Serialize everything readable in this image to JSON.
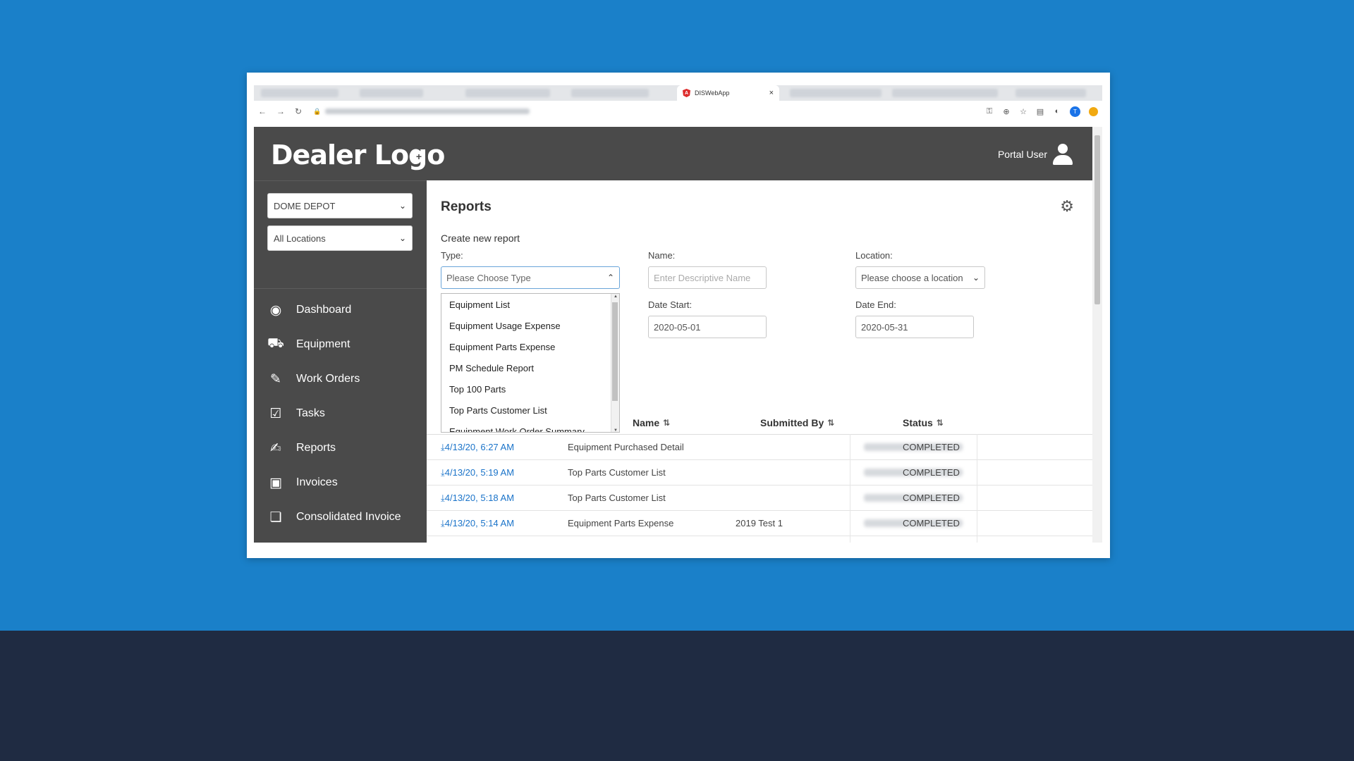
{
  "browser": {
    "active_tab_title": "DISWebApp",
    "tab_close": "×",
    "back": "←",
    "forward": "→",
    "reload": "↻",
    "lock": "🔒",
    "profile_initial": "T"
  },
  "header": {
    "logo": "Dealer Logo",
    "user_name": "Portal User"
  },
  "sidebar": {
    "customer_select": "DOME DEPOT",
    "location_select": "All Locations",
    "items": [
      {
        "label": "Dashboard",
        "icon": "eye-icon"
      },
      {
        "label": "Equipment",
        "icon": "forklift-icon"
      },
      {
        "label": "Work Orders",
        "icon": "clipboard-edit-icon"
      },
      {
        "label": "Tasks",
        "icon": "checkbox-icon"
      },
      {
        "label": "Reports",
        "icon": "report-icon"
      },
      {
        "label": "Invoices",
        "icon": "invoice-icon"
      },
      {
        "label": "Consolidated Invoice",
        "icon": "stacked-invoice-icon"
      }
    ]
  },
  "main": {
    "title": "Reports",
    "create_label": "Create new report",
    "form": {
      "type_label": "Type:",
      "type_placeholder": "Please Choose Type",
      "name_label": "Name:",
      "name_placeholder": "Enter Descriptive Name",
      "location_label": "Location:",
      "location_value": "Please choose a location",
      "date_start_label": "Date Start:",
      "date_start_value": "2020-05-01",
      "date_end_label": "Date End:",
      "date_end_value": "2020-05-31"
    },
    "type_options": [
      "Equipment List",
      "Equipment Usage Expense",
      "Equipment Parts Expense",
      "PM Schedule Report",
      "Top 100 Parts",
      "Top Parts Customer List",
      "Equipment Work Order Summary"
    ],
    "table": {
      "headers": {
        "name": "Name",
        "submitted_by": "Submitted By",
        "status": "Status"
      },
      "rows": [
        {
          "date": "4/13/20, 6:27 AM",
          "type": "Equipment Purchased Detail",
          "name": "",
          "status": "COMPLETED"
        },
        {
          "date": "4/13/20, 5:19 AM",
          "type": "Top Parts Customer List",
          "name": "",
          "status": "COMPLETED"
        },
        {
          "date": "4/13/20, 5:18 AM",
          "type": "Top Parts Customer List",
          "name": "",
          "status": "COMPLETED"
        },
        {
          "date": "4/13/20, 5:14 AM",
          "type": "Equipment Parts Expense",
          "name": "2019 Test 1",
          "status": "COMPLETED"
        }
      ]
    }
  },
  "colors": {
    "background": "#1a80c9",
    "header": "#4a4a4a",
    "link": "#1a73c9"
  }
}
